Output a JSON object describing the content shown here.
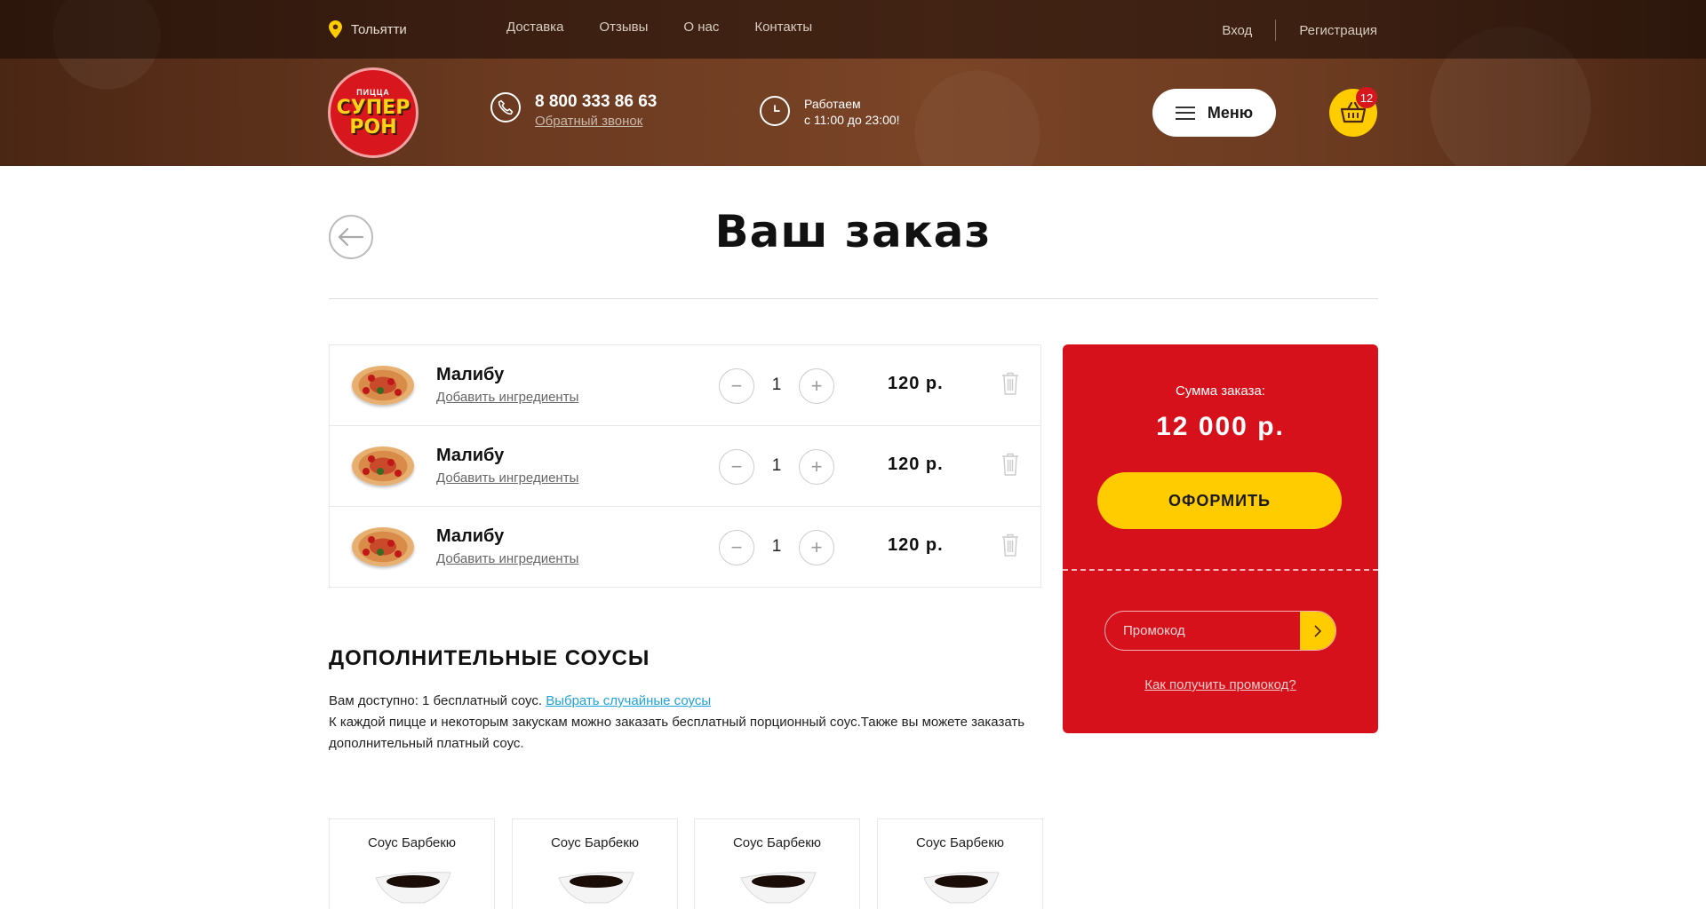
{
  "header": {
    "city": "Тольятти",
    "nav": [
      "Доставка",
      "Отзывы",
      "О нас",
      "Контакты"
    ],
    "login": "Вход",
    "register": "Регистрация",
    "logo_small": "ПИЦЦА",
    "logo_line1": "СУПЕР",
    "logo_line2": "РОН",
    "phone": "8 800 333 86 63",
    "callback": "Обратный звонок",
    "hours_line1": "Работаем",
    "hours_line2": "с 11:00 до 23:00!",
    "menu_label": "Меню",
    "cart_count": "12"
  },
  "page": {
    "title": "Ваш заказ"
  },
  "cart": {
    "items": [
      {
        "name": "Малибу",
        "link": "Добавить ингредиенты",
        "qty": "1",
        "price": "120 р."
      },
      {
        "name": "Малибу",
        "link": "Добавить ингредиенты",
        "qty": "1",
        "price": "120 р."
      },
      {
        "name": "Малибу",
        "link": "Добавить ингредиенты",
        "qty": "1",
        "price": "120 р."
      }
    ]
  },
  "summary": {
    "label": "Сумма заказа:",
    "total": "12 000 р.",
    "checkout": "ОФОРМИТЬ",
    "promo_placeholder": "Промокод",
    "promo_help": "Как получить промокод?"
  },
  "sauces": {
    "title": "ДОПОЛНИТЕЛЬНЫЕ СОУСЫ",
    "available": "Вам доступно: 1 бесплатный соус.",
    "choose_link": "Выбрать случайные соусы",
    "description": "К каждой пицце и некоторым закускам можно заказать бесплатный порционный соус.Также вы можете заказать дополнительный платный соус.",
    "cards": [
      {
        "name": "Соус Барбекю"
      },
      {
        "name": "Соус Барбекю"
      },
      {
        "name": "Соус Барбекю"
      },
      {
        "name": "Соус Барбекю"
      }
    ]
  },
  "colors": {
    "brand_red": "#d7111b",
    "brand_yellow": "#ffcc00",
    "header_brown": "#6b3a20",
    "link_blue": "#1fa3d8"
  }
}
